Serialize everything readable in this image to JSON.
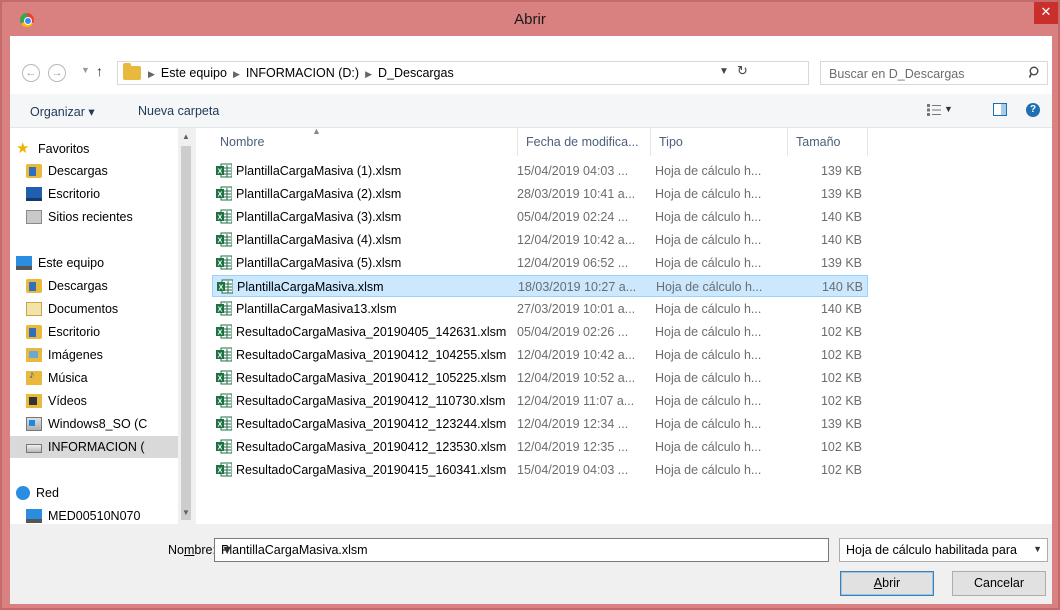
{
  "window": {
    "title": "Abrir",
    "close_glyph": "✕"
  },
  "address": {
    "crumbs": [
      "Este equipo",
      "INFORMACION (D:)",
      "D_Descargas"
    ]
  },
  "search": {
    "placeholder": "Buscar en D_Descargas"
  },
  "toolbar": {
    "organize": "Organizar ▾",
    "new_folder": "Nueva carpeta"
  },
  "nav": {
    "items": [
      {
        "label": "Favoritos",
        "icon": "star-icon"
      },
      {
        "label": "Descargas",
        "icon": "downloads-folder-icon"
      },
      {
        "label": "Escritorio",
        "icon": "desktop-icon"
      },
      {
        "label": "Sitios recientes",
        "icon": "recent-places-icon"
      },
      {
        "label": "Este equipo",
        "icon": "computer-icon"
      },
      {
        "label": "Descargas",
        "icon": "downloads-folder-icon"
      },
      {
        "label": "Documentos",
        "icon": "documents-icon"
      },
      {
        "label": "Escritorio",
        "icon": "desktop-icon"
      },
      {
        "label": "Imágenes",
        "icon": "pictures-icon"
      },
      {
        "label": "Música",
        "icon": "music-icon"
      },
      {
        "label": "Vídeos",
        "icon": "videos-icon"
      },
      {
        "label": "Windows8_SO (C",
        "icon": "windows-drive-icon"
      },
      {
        "label": "INFORMACION (",
        "icon": "drive-icon"
      },
      {
        "label": "Red",
        "icon": "network-icon"
      },
      {
        "label": "MED00510N070",
        "icon": "computer-icon"
      }
    ]
  },
  "columns": {
    "name": "Nombre",
    "date": "Fecha de modifica...",
    "type": "Tipo",
    "size": "Tamaño"
  },
  "files": [
    {
      "name": "PlantillaCargaMasiva (1).xlsm",
      "date": "15/04/2019 04:03 ...",
      "type": "Hoja de cálculo h...",
      "size": "139 KB"
    },
    {
      "name": "PlantillaCargaMasiva (2).xlsm",
      "date": "28/03/2019 10:41 a...",
      "type": "Hoja de cálculo h...",
      "size": "139 KB"
    },
    {
      "name": "PlantillaCargaMasiva (3).xlsm",
      "date": "05/04/2019 02:24 ...",
      "type": "Hoja de cálculo h...",
      "size": "140 KB"
    },
    {
      "name": "PlantillaCargaMasiva (4).xlsm",
      "date": "12/04/2019 10:42 a...",
      "type": "Hoja de cálculo h...",
      "size": "140 KB"
    },
    {
      "name": "PlantillaCargaMasiva (5).xlsm",
      "date": "12/04/2019 06:52 ...",
      "type": "Hoja de cálculo h...",
      "size": "139 KB"
    },
    {
      "name": "PlantillaCargaMasiva.xlsm",
      "date": "18/03/2019 10:27 a...",
      "type": "Hoja de cálculo h...",
      "size": "140 KB"
    },
    {
      "name": "PlantillaCargaMasiva13.xlsm",
      "date": "27/03/2019 10:01 a...",
      "type": "Hoja de cálculo h...",
      "size": "140 KB"
    },
    {
      "name": "ResultadoCargaMasiva_20190405_142631.xlsm",
      "date": "05/04/2019 02:26 ...",
      "type": "Hoja de cálculo h...",
      "size": "102 KB"
    },
    {
      "name": "ResultadoCargaMasiva_20190412_104255.xlsm",
      "date": "12/04/2019 10:42 a...",
      "type": "Hoja de cálculo h...",
      "size": "102 KB"
    },
    {
      "name": "ResultadoCargaMasiva_20190412_105225.xlsm",
      "date": "12/04/2019 10:52 a...",
      "type": "Hoja de cálculo h...",
      "size": "102 KB"
    },
    {
      "name": "ResultadoCargaMasiva_20190412_110730.xlsm",
      "date": "12/04/2019 11:07 a...",
      "type": "Hoja de cálculo h...",
      "size": "102 KB"
    },
    {
      "name": "ResultadoCargaMasiva_20190412_123244.xlsm",
      "date": "12/04/2019 12:34 ...",
      "type": "Hoja de cálculo h...",
      "size": "139 KB"
    },
    {
      "name": "ResultadoCargaMasiva_20190412_123530.xlsm",
      "date": "12/04/2019 12:35 ...",
      "type": "Hoja de cálculo h...",
      "size": "102 KB"
    },
    {
      "name": "ResultadoCargaMasiva_20190415_160341.xlsm",
      "date": "15/04/2019 04:03 ...",
      "type": "Hoja de cálculo h...",
      "size": "102 KB"
    }
  ],
  "selected_index": 5,
  "footer": {
    "filename_label_pre": "No",
    "filename_label_u": "m",
    "filename_label_post": "bre:",
    "filename_value": "PlantillaCargaMasiva.xlsm",
    "file_type": "Hoja de cálculo habilitada para",
    "open_u": "A",
    "open_rest": "brir",
    "cancel": "Cancelar"
  },
  "colors": {
    "titlebar": "#d98080",
    "close": "#c9302c",
    "selection": "#cce8ff"
  }
}
